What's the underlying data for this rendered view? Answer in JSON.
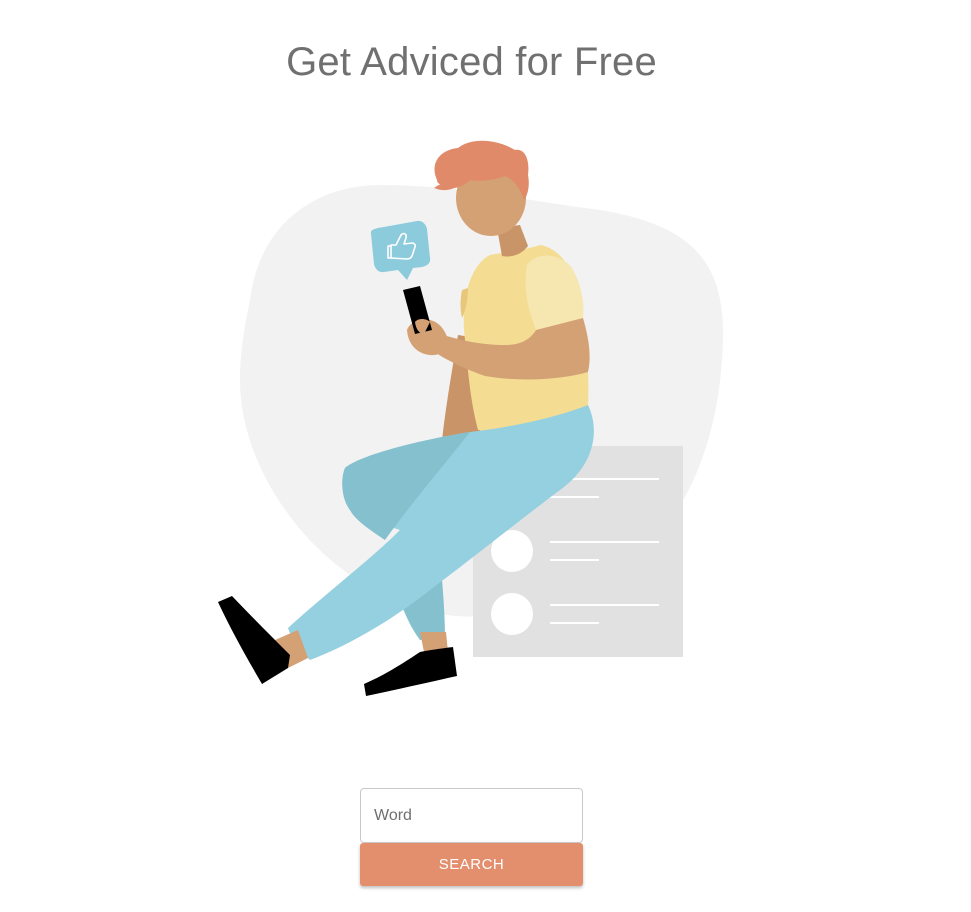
{
  "header": {
    "title": "Get Adviced for Free"
  },
  "illustration": {
    "icon": "person-with-phone-illustration",
    "colors": {
      "blob": "#f2f2f2",
      "card": "#e1e1e1",
      "hair": "#e08a6a",
      "skin": "#d4a175",
      "shirt": "#f4dd93",
      "pants": "#95d0e0",
      "shoes": "#000000",
      "like_bubble": "#8ccbdc"
    }
  },
  "search": {
    "placeholder": "Word",
    "value": "",
    "button_label": "SEARCH",
    "button_color": "#e38f6d"
  }
}
